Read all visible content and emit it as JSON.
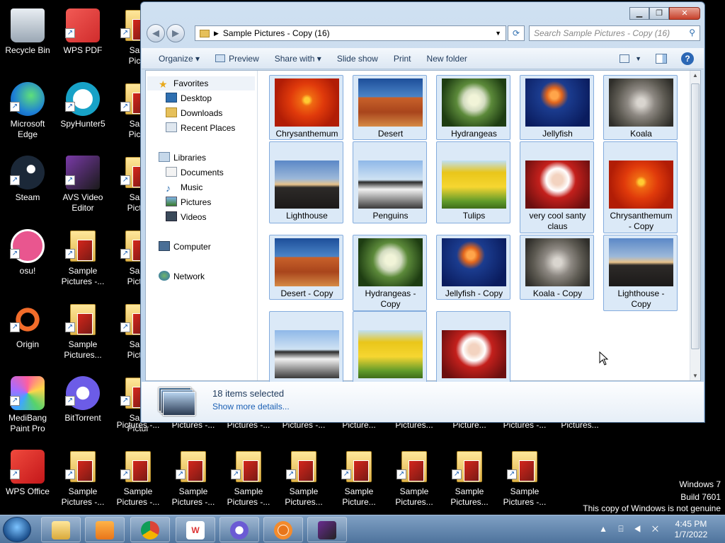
{
  "desktop": {
    "col1": [
      {
        "label": "Recycle Bin",
        "icon": "recycle-bin"
      },
      {
        "label": "Microsoft\nEdge",
        "icon": "edge"
      },
      {
        "label": "Steam",
        "icon": "steam"
      },
      {
        "label": "osu!",
        "icon": "osu"
      },
      {
        "label": "Origin",
        "icon": "origin"
      },
      {
        "label": "MediBang\nPaint Pro",
        "icon": "medibang"
      },
      {
        "label": "WPS Office",
        "icon": "wps-office"
      }
    ],
    "col2": [
      {
        "label": "WPS PDF",
        "icon": "wps-pdf"
      },
      {
        "label": "SpyHunter5",
        "icon": "spyhunter"
      },
      {
        "label": "AVS Video\nEditor",
        "icon": "avs-video"
      },
      {
        "label": "Sample\nPictures -...",
        "icon": "folder"
      },
      {
        "label": "Sample\nPictures...",
        "icon": "folder"
      },
      {
        "label": "BitTorrent",
        "icon": "bittorrent"
      },
      {
        "label": "Sample\nPictures -...",
        "icon": "folder"
      }
    ],
    "col3_partial": [
      "Sam\nPictu",
      "Sam\nPictu",
      "Sam\nPictur",
      "Sam\nPictur",
      "Sam\nPictur",
      "Sam\nPictur"
    ],
    "bottom_row": [
      "Sample\nPictures -...",
      "Sample\nPictures -...",
      "Sample\nPictures -...",
      "Sample\nPictures...",
      "Sample\nPicture...",
      "Sample\nPictures...",
      "Sample\nPictures...",
      "Sample\nPictures -..."
    ],
    "behind_window_labels": [
      "Pictures -...",
      "Pictures -...",
      "Pictures -...",
      "Pictures -...",
      "Picture...",
      "Pictures...",
      "Picture...",
      "Pictures -...",
      "Pictures..."
    ]
  },
  "window": {
    "address": "Sample Pictures - Copy (16)",
    "search_placeholder": "Search Sample Pictures - Copy (16)",
    "toolbar": {
      "organize": "Organize ▾",
      "preview": "Preview",
      "share": "Share with ▾",
      "slideshow": "Slide show",
      "print": "Print",
      "new_folder": "New folder"
    },
    "nav": {
      "favorites": "Favorites",
      "desktop": "Desktop",
      "downloads": "Downloads",
      "recent": "Recent Places",
      "libraries": "Libraries",
      "documents": "Documents",
      "music": "Music",
      "pictures": "Pictures",
      "videos": "Videos",
      "computer": "Computer",
      "network": "Network"
    },
    "files": [
      {
        "name": "Chrysanthemum",
        "kind": "chrysanthemum"
      },
      {
        "name": "Desert",
        "kind": "desert"
      },
      {
        "name": "Hydrangeas",
        "kind": "hydrangeas"
      },
      {
        "name": "Jellyfish",
        "kind": "jellyfish"
      },
      {
        "name": "Koala",
        "kind": "koala"
      },
      {
        "name": "Lighthouse",
        "kind": "lighthouse"
      },
      {
        "name": "Penguins",
        "kind": "penguins"
      },
      {
        "name": "Tulips",
        "kind": "tulips"
      },
      {
        "name": "very cool santy\nclaus",
        "kind": "santa"
      },
      {
        "name": "Chrysanthemum\n- Copy",
        "kind": "chrysanthemum"
      },
      {
        "name": "Desert - Copy",
        "kind": "desert"
      },
      {
        "name": "Hydrangeas -\nCopy",
        "kind": "hydrangeas"
      },
      {
        "name": "Jellyfish - Copy",
        "kind": "jellyfish"
      },
      {
        "name": "Koala - Copy",
        "kind": "koala"
      },
      {
        "name": "Lighthouse -\nCopy",
        "kind": "lighthouse"
      },
      {
        "name": "",
        "kind": "penguins"
      },
      {
        "name": "",
        "kind": "tulips"
      },
      {
        "name": "",
        "kind": "santa"
      }
    ],
    "details": {
      "count": "18 items selected",
      "more": "Show more details..."
    }
  },
  "taskbar": {
    "time": "4:45 PM",
    "date": "1/7/2022",
    "tray_icons": "▲ ⌸ ◀ ✕"
  },
  "watermark": {
    "line1": "Windows 7",
    "line2": "Build 7601",
    "line3": "This copy of Windows is not genuine"
  },
  "colors": {
    "selection": "#dbe9f7",
    "selection_border": "#84acdd",
    "link": "#1a5fb4"
  }
}
